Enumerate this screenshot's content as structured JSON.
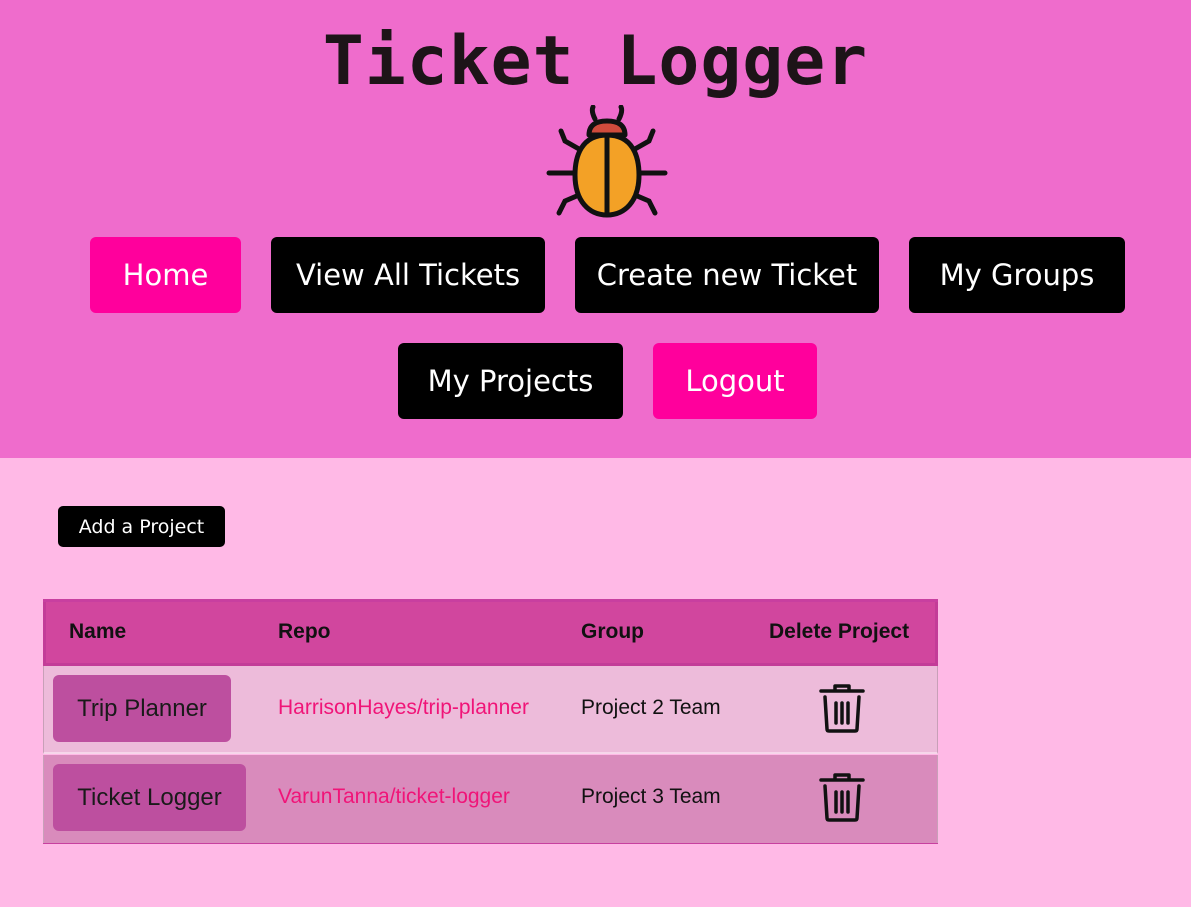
{
  "header": {
    "title": "Ticket Logger",
    "logo_icon": "bug-icon"
  },
  "nav": {
    "home": "Home",
    "view_all": "View All Tickets",
    "create": "Create new Ticket",
    "groups": "My Groups",
    "projects": "My Projects",
    "logout": "Logout"
  },
  "actions": {
    "add_project": "Add a Project"
  },
  "table": {
    "headers": {
      "name": "Name",
      "repo": "Repo",
      "group": "Group",
      "delete": "Delete Project"
    },
    "rows": [
      {
        "name": "Trip Planner",
        "repo": "HarrisonHayes/trip-planner",
        "group": "Project 2 Team"
      },
      {
        "name": "Ticket Logger",
        "repo": "VarunTanna/ticket-logger",
        "group": "Project 3 Team"
      }
    ]
  },
  "colors": {
    "header_bg": "#ef6ccc",
    "page_bg": "#ffb9e6",
    "accent_pink": "#ff009c",
    "link": "#f01478"
  }
}
